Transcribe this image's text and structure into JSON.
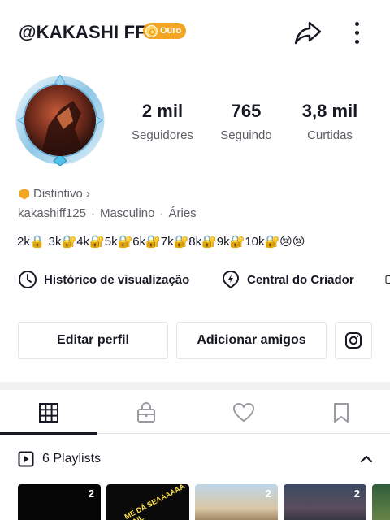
{
  "header": {
    "username": "@KAKASHI FF",
    "badge_label": "Ouro"
  },
  "stats": [
    {
      "value": "2 mil",
      "label": "Seguidores"
    },
    {
      "value": "765",
      "label": "Seguindo"
    },
    {
      "value": "3,8 mil",
      "label": "Curtidas"
    }
  ],
  "profile": {
    "distintivo": "Distintivo ›",
    "handle": "kakashiff125",
    "gender": "Masculino",
    "sign": "Áries",
    "separator": "·",
    "bio": "2k🔒 3k🔐4k🔐5k🔐6k🔐7k🔐8k🔐9k🔐10k🔐😢😢"
  },
  "links": {
    "history": "Histórico de visualização",
    "creator": "Central do Criador"
  },
  "buttons": {
    "edit": "Editar perfil",
    "add_friends": "Adicionar amigos"
  },
  "tabs": [
    "videos-grid-icon",
    "private-lock-icon",
    "liked-heart-icon",
    "favorites-bookmark-icon"
  ],
  "playlists": {
    "label": "6 Playlists",
    "items": [
      {
        "count": "2",
        "thumb_text": ""
      },
      {
        "count": "",
        "thumb_text": "ME DÁ SEAAAAAA PAIL"
      },
      {
        "count": "2",
        "thumb_text": ""
      },
      {
        "count": "2",
        "thumb_text": ""
      }
    ]
  },
  "colors": {
    "accent_gold": "#f2a623",
    "text_primary": "#161823",
    "text_secondary": "#5e5f66"
  }
}
